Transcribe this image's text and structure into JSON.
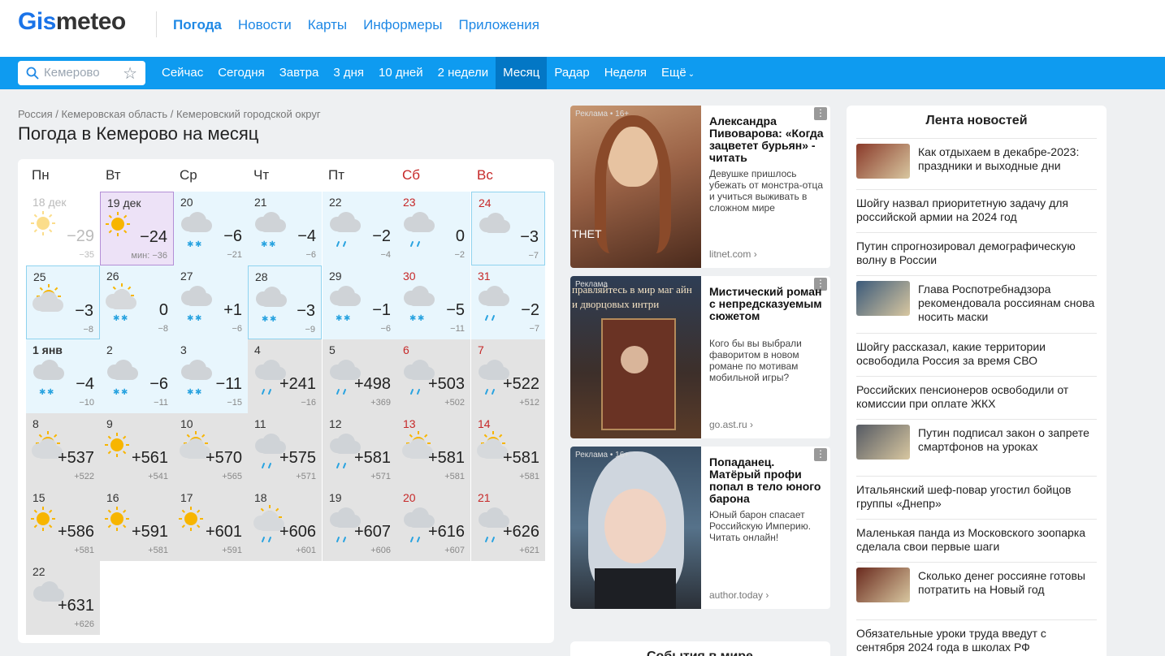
{
  "header": {
    "logo_part1": "Gis",
    "logo_part2": "meteo",
    "nav": [
      "Погода",
      "Новости",
      "Карты",
      "Информеры",
      "Приложения"
    ]
  },
  "bar": {
    "search_placeholder": "Кемерово",
    "items": [
      "Сейчас",
      "Сегодня",
      "Завтра",
      "3 дня",
      "10 дней",
      "2 недели",
      "Месяц",
      "Радар",
      "Неделя",
      "Ещё"
    ],
    "active": "Месяц",
    "more_arrow": "⌄"
  },
  "breadcrumb": "Россия / Кемеровская область / Кемеровский городской округ",
  "page_title": "Погода в Кемерово на месяц",
  "calendar": {
    "weekdays": [
      "Пн",
      "Вт",
      "Ср",
      "Чт",
      "Пт",
      "Сб",
      "Вс"
    ],
    "today_min_label": "мин:",
    "days": [
      {
        "d": "18 дек",
        "max": "−29",
        "min": "−35",
        "icon": "sun",
        "style": "past"
      },
      {
        "d": "19 дек",
        "max": "−24",
        "min": "−36",
        "icon": "sun",
        "style": "today"
      },
      {
        "d": "20",
        "max": "−6",
        "min": "−21",
        "icon": "cloud-snow",
        "style": "blue"
      },
      {
        "d": "21",
        "max": "−4",
        "min": "−6",
        "icon": "cloud-snow",
        "style": "blue"
      },
      {
        "d": "22",
        "max": "−2",
        "min": "−4",
        "icon": "cloud-rain",
        "style": "blue"
      },
      {
        "d": "23",
        "max": "0",
        "min": "−2",
        "icon": "cloud-rain",
        "style": "blue",
        "we": true
      },
      {
        "d": "24",
        "max": "−3",
        "min": "−7",
        "icon": "cloud",
        "style": "blue",
        "we": true
      },
      {
        "d": "25",
        "max": "−3",
        "min": "−8",
        "icon": "sun-cloud",
        "style": "blue"
      },
      {
        "d": "26",
        "max": "0",
        "min": "−8",
        "icon": "sun-cloud-snow",
        "style": "blue"
      },
      {
        "d": "27",
        "max": "+1",
        "min": "−6",
        "icon": "cloud-snow",
        "style": "blue"
      },
      {
        "d": "28",
        "max": "−3",
        "min": "−9",
        "icon": "cloud-snow",
        "style": "blue"
      },
      {
        "d": "29",
        "max": "−1",
        "min": "−6",
        "icon": "cloud-snow",
        "style": "blue"
      },
      {
        "d": "30",
        "max": "−5",
        "min": "−11",
        "icon": "cloud-snow",
        "style": "blue",
        "we": true
      },
      {
        "d": "31",
        "max": "−2",
        "min": "−7",
        "icon": "cloud-rain",
        "style": "blue",
        "we": true
      },
      {
        "d": "1 янв",
        "max": "−4",
        "min": "−10",
        "icon": "cloud-snow",
        "style": "blue",
        "bold": true
      },
      {
        "d": "2",
        "max": "−6",
        "min": "−11",
        "icon": "cloud-snow",
        "style": "blue"
      },
      {
        "d": "3",
        "max": "−11",
        "min": "−15",
        "icon": "cloud-snow",
        "style": "blue"
      },
      {
        "d": "4",
        "max": "+241",
        "min": "−16",
        "icon": "cloud-rain",
        "style": "grey"
      },
      {
        "d": "5",
        "max": "+498",
        "min": "+369",
        "icon": "cloud-rain",
        "style": "grey"
      },
      {
        "d": "6",
        "max": "+503",
        "min": "+502",
        "icon": "cloud-rain",
        "style": "grey",
        "we": true
      },
      {
        "d": "7",
        "max": "+522",
        "min": "+512",
        "icon": "cloud-rain",
        "style": "grey",
        "we": true
      },
      {
        "d": "8",
        "max": "+537",
        "min": "+522",
        "icon": "sun-cloud",
        "style": "grey"
      },
      {
        "d": "9",
        "max": "+561",
        "min": "+541",
        "icon": "sun",
        "style": "grey"
      },
      {
        "d": "10",
        "max": "+570",
        "min": "+565",
        "icon": "sun-cloud",
        "style": "grey"
      },
      {
        "d": "11",
        "max": "+575",
        "min": "+571",
        "icon": "cloud-rain",
        "style": "grey"
      },
      {
        "d": "12",
        "max": "+581",
        "min": "+571",
        "icon": "cloud-rain",
        "style": "grey"
      },
      {
        "d": "13",
        "max": "+581",
        "min": "+581",
        "icon": "sun-cloud",
        "style": "grey",
        "we": true
      },
      {
        "d": "14",
        "max": "+581",
        "min": "+581",
        "icon": "sun-cloud",
        "style": "grey",
        "we": true
      },
      {
        "d": "15",
        "max": "+586",
        "min": "+581",
        "icon": "sun",
        "style": "grey"
      },
      {
        "d": "16",
        "max": "+591",
        "min": "+581",
        "icon": "sun",
        "style": "grey"
      },
      {
        "d": "17",
        "max": "+601",
        "min": "+591",
        "icon": "sun",
        "style": "grey"
      },
      {
        "d": "18",
        "max": "+606",
        "min": "+601",
        "icon": "sun-cloud-rain",
        "style": "grey"
      },
      {
        "d": "19",
        "max": "+607",
        "min": "+606",
        "icon": "cloud-rain",
        "style": "grey"
      },
      {
        "d": "20",
        "max": "+616",
        "min": "+607",
        "icon": "cloud-rain",
        "style": "grey",
        "we": true
      },
      {
        "d": "21",
        "max": "+626",
        "min": "+621",
        "icon": "cloud-rain",
        "style": "grey",
        "we": true
      },
      {
        "d": "22",
        "max": "+631",
        "min": "+626",
        "icon": "cloud",
        "style": "grey"
      }
    ]
  },
  "ads": [
    {
      "label": "Реклама • 16+",
      "title": "Александра Пивоварова: «Когда зацветет бурьян» - читать",
      "desc": "Девушке пришлось убежать от монстра-отца и учиться выживать в сложном мире",
      "src": "litnet.com",
      "img_text": "THET"
    },
    {
      "label": "Реклама",
      "title": "Мистический роман с непредсказуемым сюжетом",
      "desc": "Кого бы вы выбрали фаворитом в новом романе по мотивам мобильной игры?",
      "src": "go.ast.ru",
      "img_text": "правляйтесь в мир маг айн и дворцовых интри"
    },
    {
      "label": "Реклама • 16+",
      "title": "Попаданец. Матёрый профи попал в тело юного барона",
      "desc": "Юный барон спасает Российскую Империю. Читать онлайн!",
      "src": "author.today",
      "img_text": ""
    }
  ],
  "ad_more_title": "События в мире",
  "news": {
    "title": "Лента новостей",
    "items": [
      {
        "text": "Как отдыхаем в декабре-2023: праздники и выходные дни",
        "thumb": "#8a3a2a"
      },
      {
        "text": "Шойгу назвал приоритетную задачу для российской армии на 2024 год",
        "thumb": ""
      },
      {
        "text": "Путин спрогнозировал демографическую волну в России",
        "thumb": ""
      },
      {
        "text": "Глава Роспотребнадзора рекомендовала россиянам снова носить маски",
        "thumb": "#3b5a7a"
      },
      {
        "text": "Шойгу рассказал, какие территории освободила Россия за время СВО",
        "thumb": ""
      },
      {
        "text": "Российских пенсионеров освободили от комиссии при оплате ЖКХ",
        "thumb": ""
      },
      {
        "text": "Путин подписал закон о запрете смартфонов на уроках",
        "thumb": "#555a63"
      },
      {
        "text": "Итальянский шеф-повар угостил бойцов группы «Днепр»",
        "thumb": ""
      },
      {
        "text": "Маленькая панда из Московского зоопарка сделала свои первые шаги",
        "thumb": ""
      },
      {
        "text": "Сколько денег россияне готовы потратить на Новый год",
        "thumb": "#6a2a1e"
      },
      {
        "text": "Обязательные уроки труда введут с сентября 2024 года в школах РФ",
        "thumb": ""
      }
    ]
  },
  "colors": {
    "brand": "#0e9bf0",
    "active_tab": "#0377c5",
    "weekend": "#c62828",
    "link": "#1e88e5"
  }
}
